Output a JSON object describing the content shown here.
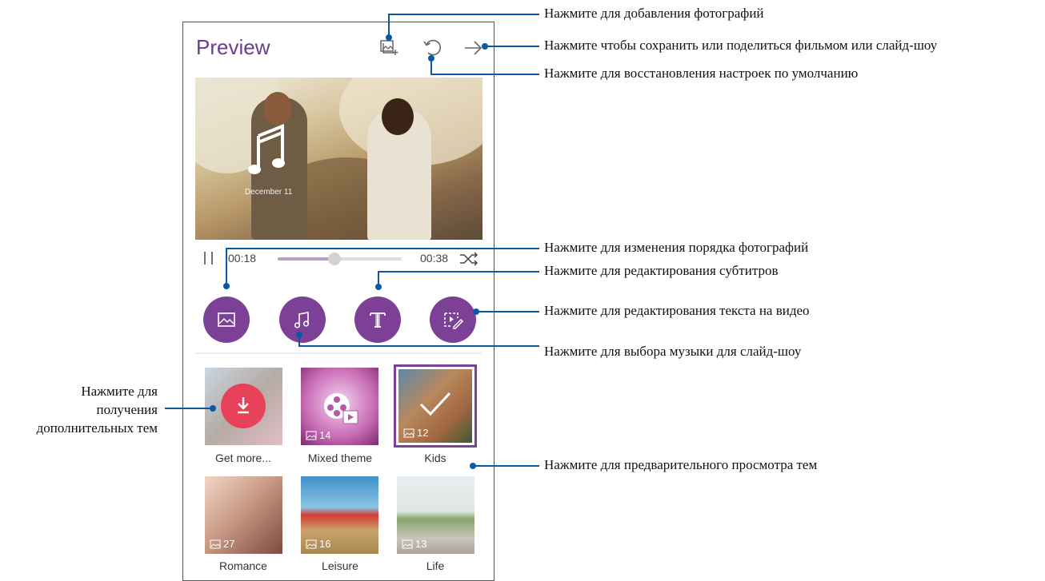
{
  "app": {
    "title": "Preview"
  },
  "icons": {
    "add_photos": "add-photo-icon",
    "reset": "reset-icon",
    "share": "share-arrow-icon"
  },
  "hero": {
    "date_text": "December 11"
  },
  "player": {
    "elapsed": "00:18",
    "total": "00:38",
    "progress": 0.46
  },
  "actions": [
    {
      "name": "reorder-photos",
      "icon": "image-icon"
    },
    {
      "name": "music",
      "icon": "music-note-icon"
    },
    {
      "name": "subtitles",
      "icon": "text-t-icon"
    },
    {
      "name": "video-text",
      "icon": "edit-frame-icon"
    }
  ],
  "themes": [
    {
      "label": "Get more...",
      "count": ""
    },
    {
      "label": "Mixed theme",
      "count": "14"
    },
    {
      "label": "Kids",
      "count": "12",
      "selected": true
    },
    {
      "label": "Romance",
      "count": "27"
    },
    {
      "label": "Leisure",
      "count": "16"
    },
    {
      "label": "Life",
      "count": "13"
    }
  ],
  "annotations": {
    "add_photos": "Нажмите для добавления фотографий",
    "save_share": "Нажмите чтобы сохранить или поделиться фильмом или слайд-шоу",
    "reset": "Нажмите для восстановления настроек по умолчанию",
    "reorder": "Нажмите для изменения порядка фотографий",
    "subtitles": "Нажмите для редактирования субтитров",
    "video_text": "Нажмите для редактирования текста на видео",
    "music": "Нажмите для выбора музыки для слайд-шоу",
    "preview_themes": "Нажмите для предварительного просмотра тем",
    "get_themes_1": "Нажмите для",
    "get_themes_2": "получения",
    "get_themes_3": "дополнительных тем"
  },
  "colors": {
    "accent": "#7c4197",
    "callout": "#0b58a6",
    "download": "#e8415a"
  }
}
